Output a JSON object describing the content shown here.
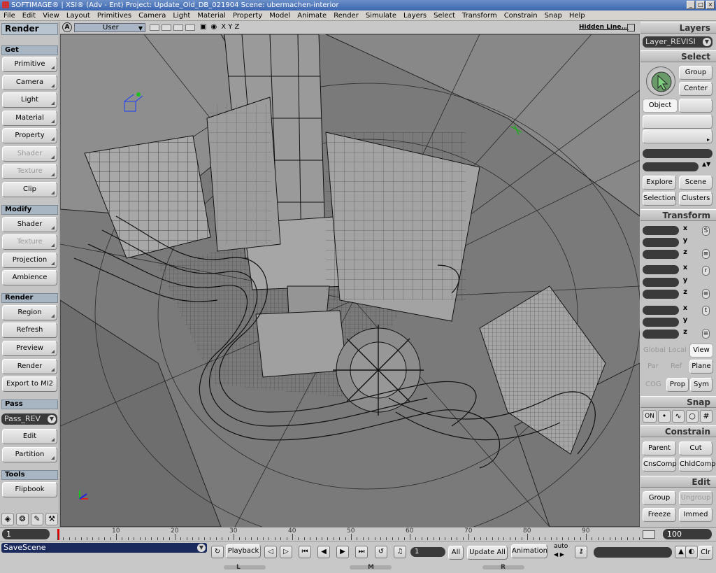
{
  "title": "SOFTIMAGE® | XSI® (Adv - Ent) Project: Update_Old_DB_021904    Scene: ubermachen-interior",
  "window_buttons": [
    "_",
    "□",
    "×"
  ],
  "menu": [
    "File",
    "Edit",
    "View",
    "Layout",
    "Primitives",
    "Camera",
    "Light",
    "Material",
    "Property",
    "Model",
    "Animate",
    "Render",
    "Simulate",
    "Layers",
    "Select",
    "Transform",
    "Constrain",
    "Snap",
    "Help"
  ],
  "left": {
    "panel_title": "Render",
    "get": {
      "label": "Get",
      "buttons": [
        "Primitive",
        "Camera",
        "Light",
        "Material",
        "Property",
        "Shader",
        "Texture",
        "Clip"
      ]
    },
    "modify": {
      "label": "Modify",
      "buttons": [
        "Shader",
        "Texture",
        "Projection",
        "Ambience"
      ]
    },
    "render": {
      "label": "Render",
      "buttons": [
        "Region",
        "Refresh",
        "Preview",
        "Render",
        "Export to MI2"
      ]
    },
    "pass": {
      "label": "Pass",
      "dropdown": "Pass_REV",
      "buttons": [
        "Edit",
        "Partition"
      ]
    },
    "tools": {
      "label": "Tools",
      "buttons": [
        "Flipbook"
      ]
    }
  },
  "viewport": {
    "letter": "A",
    "camera": "User",
    "xyz": "X Y Z",
    "display_mode": "Hidden Line..."
  },
  "right": {
    "layers": {
      "label": "Layers",
      "dropdown": "Layer_REVISI"
    },
    "select": {
      "label": "Select",
      "group": "Group",
      "center": "Center",
      "object": "Object",
      "explore": "Explore",
      "scene": "Scene",
      "selection": "Selection",
      "clusters": "Clusters"
    },
    "transform": {
      "label": "Transform",
      "axes": [
        "x",
        "y",
        "z"
      ],
      "s": "S",
      "r": "r",
      "t": "t",
      "global": "Global",
      "local": "Local",
      "view": "View",
      "par": "Par",
      "ref": "Ref",
      "plane": "Plane",
      "cog": "COG",
      "prop": "Prop",
      "sym": "Sym"
    },
    "snap": {
      "label": "Snap",
      "on": "ON"
    },
    "constrain": {
      "label": "Constrain",
      "parent": "Parent",
      "cut": "Cut",
      "cnscomp": "CnsComp",
      "chldcomp": "ChldComp"
    },
    "edit": {
      "label": "Edit",
      "group": "Group",
      "ungroup": "Ungroup",
      "freeze": "Freeze",
      "immed": "Immed"
    }
  },
  "timeline": {
    "current": "1",
    "end": "100",
    "labels": [
      "10",
      "20",
      "30",
      "40",
      "50",
      "60",
      "70",
      "80",
      "90"
    ]
  },
  "bottom": {
    "command": "SaveScene",
    "playback": "Playback",
    "frame": "1",
    "all": "All",
    "update_all": "Update All",
    "animation": "Animation",
    "auto": "auto",
    "clr": "Clr",
    "l": "L",
    "m": "M",
    "r": "R"
  }
}
